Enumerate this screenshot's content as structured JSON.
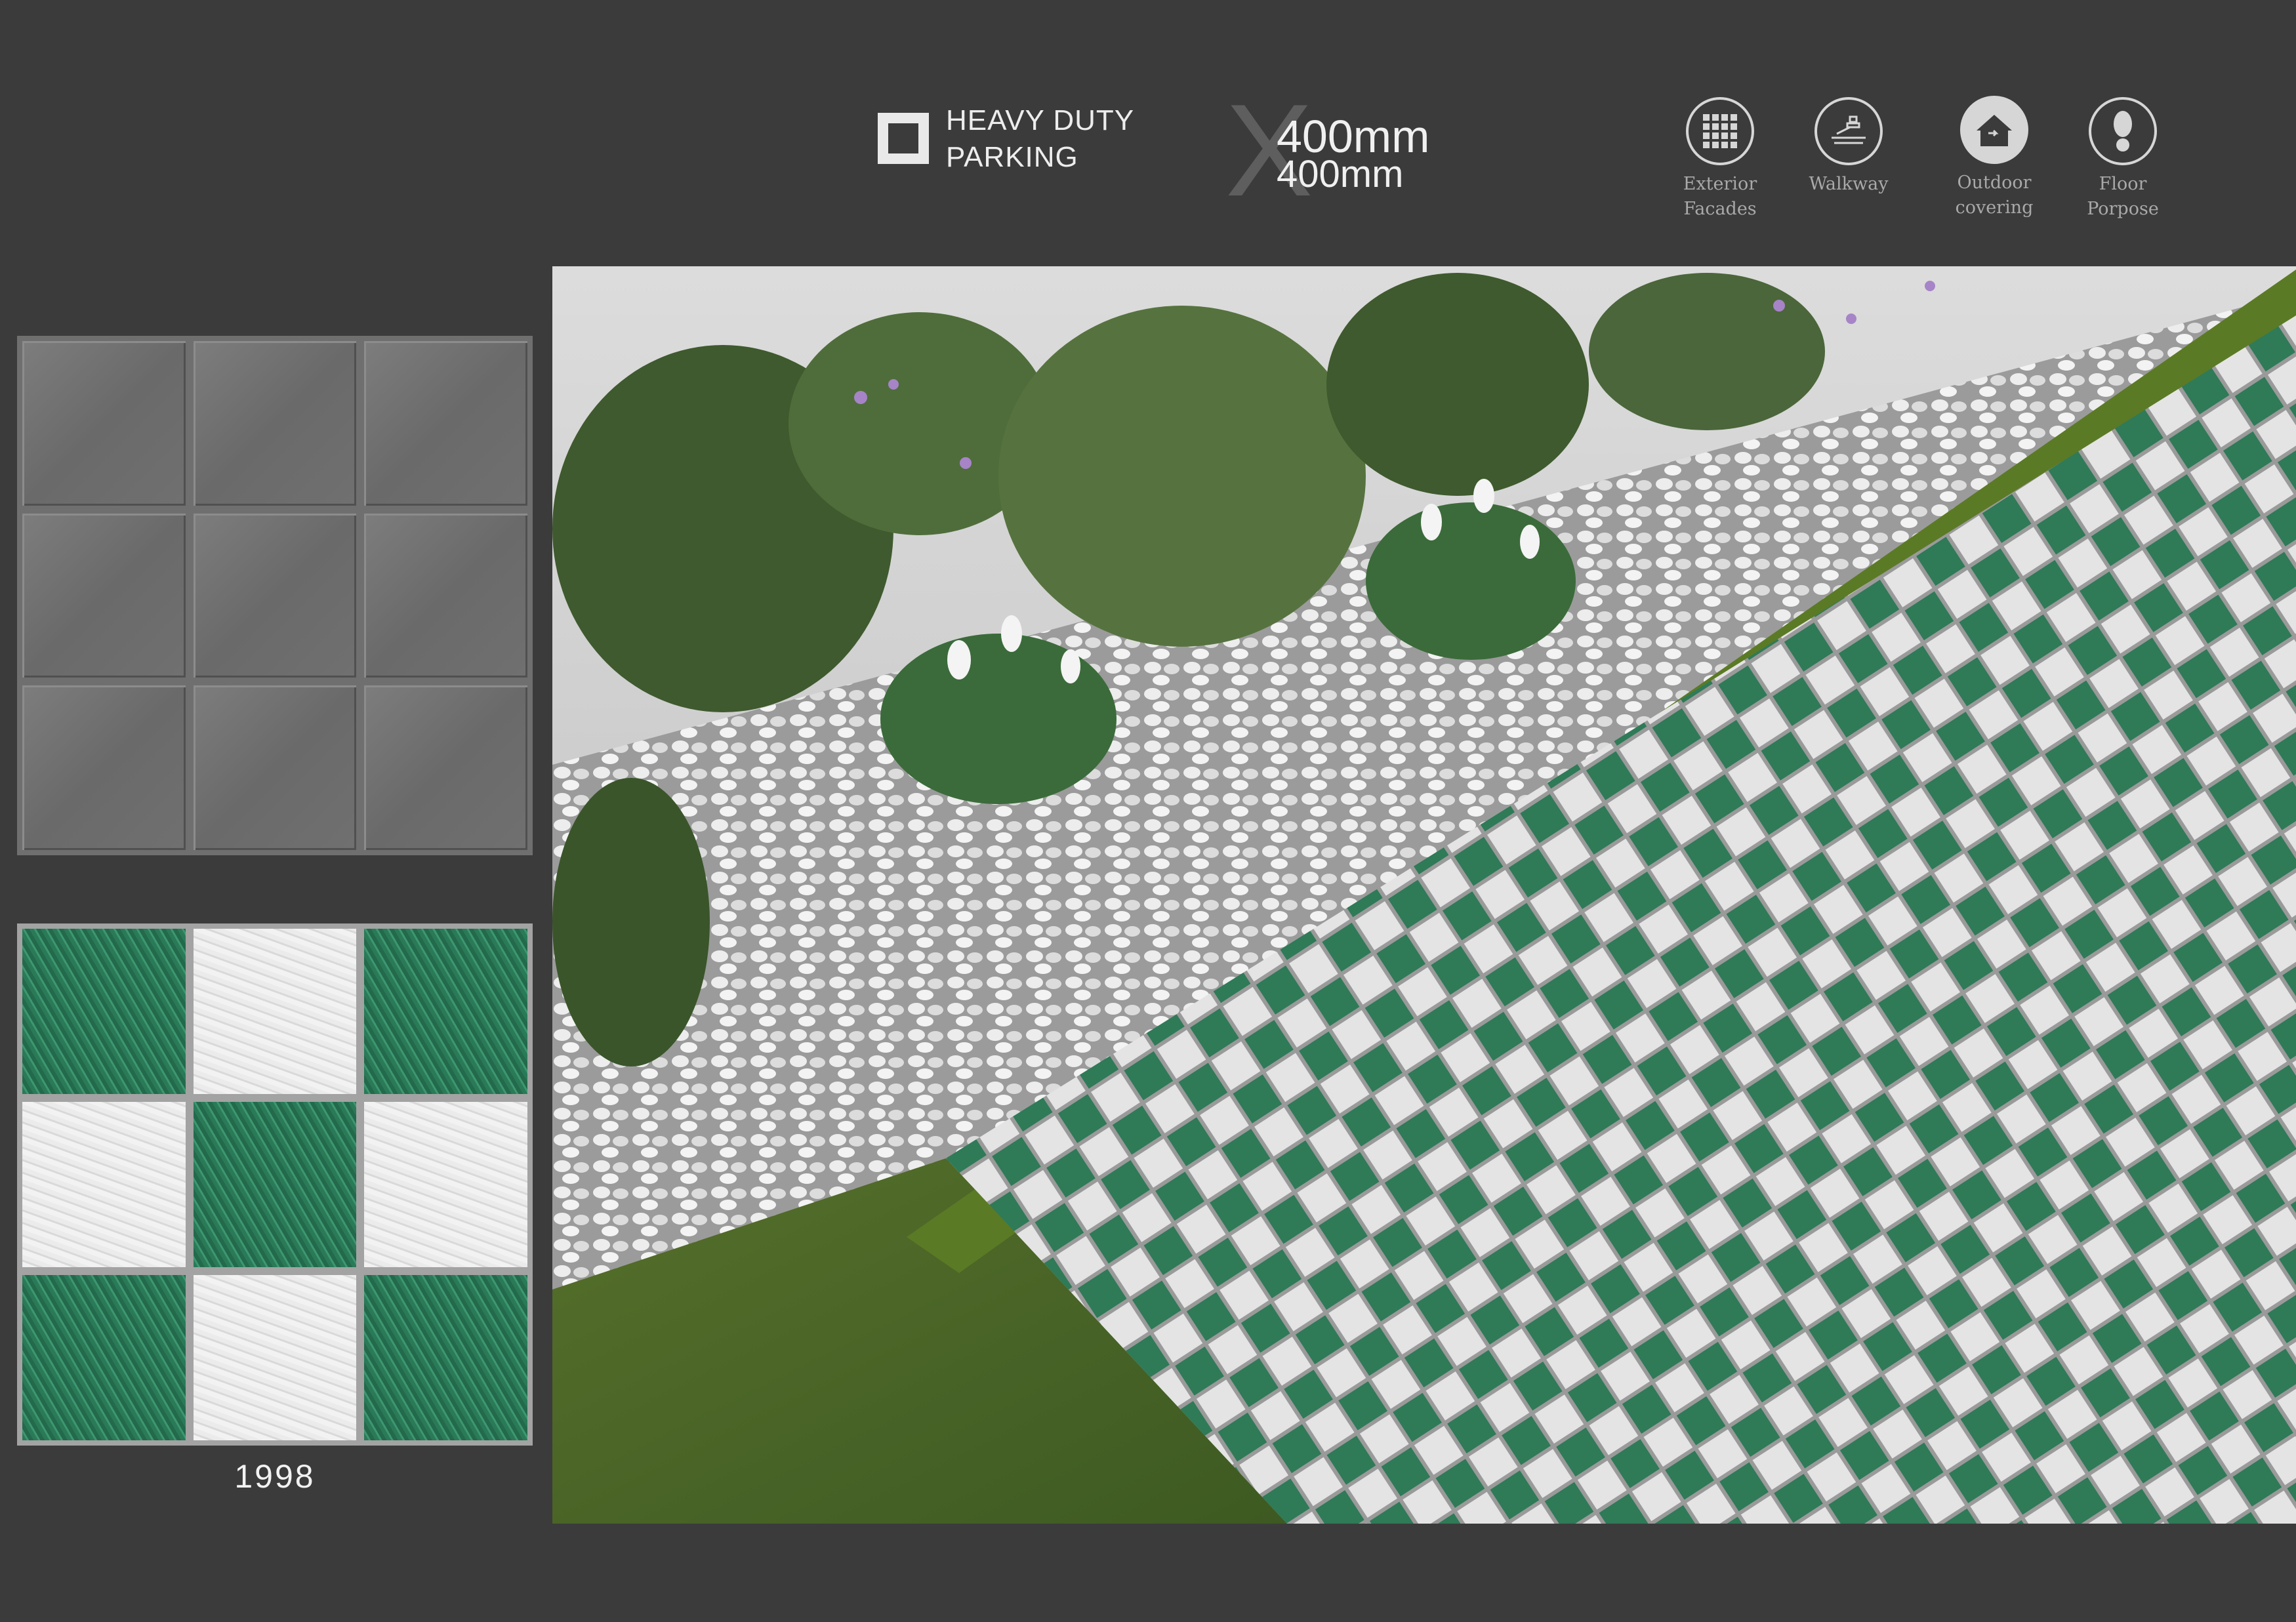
{
  "header": {
    "feature_line1": "HEAVY DUTY",
    "feature_line2": "PARKING",
    "size_line1": "400mm",
    "size_line2": "400mm",
    "usages": [
      {
        "icon": "grid-icon",
        "label": "Exterior\nFacades"
      },
      {
        "icon": "walkway-icon",
        "label": "Walkway"
      },
      {
        "icon": "house-icon",
        "label": "Outdoor\ncovering"
      },
      {
        "icon": "footprint-icon",
        "label": "Floor\nPorpose"
      }
    ]
  },
  "tile": {
    "code": "1998",
    "pattern": [
      "grass",
      "stone",
      "grass",
      "stone",
      "grass",
      "stone",
      "grass",
      "stone",
      "grass"
    ]
  },
  "colors": {
    "background": "#3b3b3c",
    "grass_green": "#2d7d5a",
    "stone_white": "#e6e6e6"
  }
}
